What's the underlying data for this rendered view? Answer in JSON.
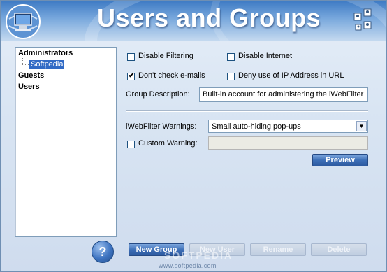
{
  "header": {
    "title": "Users and Groups"
  },
  "tree": {
    "items": [
      {
        "label": "Administrators",
        "bold": true
      },
      {
        "label": "Softpedia",
        "selected": true
      },
      {
        "label": "Guests",
        "bold": true
      },
      {
        "label": "Users",
        "bold": true
      }
    ]
  },
  "options": {
    "disable_filtering": {
      "label": "Disable Filtering",
      "checked": false
    },
    "disable_internet": {
      "label": "Disable Internet",
      "checked": false
    },
    "dont_check_emails": {
      "label": "Don't check e-mails",
      "checked": true
    },
    "deny_ip": {
      "label": "Deny use of IP Address in URL",
      "checked": false
    },
    "check_mark": "✔"
  },
  "group_description": {
    "label": "Group Description:",
    "value": "Built-in account for administering the iWebFilter"
  },
  "warnings": {
    "label": "iWebFilter Warnings:",
    "selected": "Small auto-hiding pop-ups"
  },
  "custom_warning": {
    "label": "Custom Warning:",
    "checked": false,
    "value": ""
  },
  "buttons": {
    "preview": "Preview",
    "new_group": "New Group",
    "new_user": "New User",
    "rename": "Rename",
    "delete": "Delete",
    "help": "?"
  },
  "watermark": {
    "brand": "SOFTPEDIA",
    "url": "www.softpedia.com"
  },
  "colors": {
    "accent": "#316ac5",
    "header_top": "#3d7ac4",
    "button": "#3d6fb7"
  },
  "icons": [
    "computer-globe-icon",
    "users-grid-icon",
    "help-icon",
    "dropdown-arrow-icon",
    "check-icon"
  ]
}
